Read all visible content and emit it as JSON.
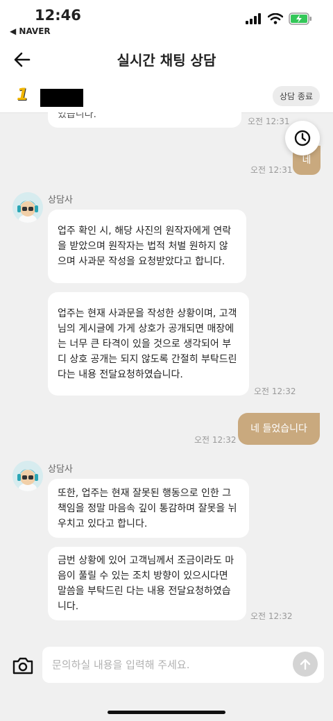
{
  "status_bar": {
    "time": "12:46",
    "back_app": "◀ NAVER"
  },
  "header": {
    "title": "실시간 채팅 상담"
  },
  "agent_bar": {
    "logo": "1",
    "end_button": "상담 종료"
  },
  "messages": {
    "m0": {
      "text": "었습니다.",
      "time": "오전 12:31"
    },
    "m1": {
      "text": "네",
      "time": "오전 12:31"
    },
    "group1": {
      "sender": "상담사",
      "b1": "업주 확인 시, 해당 사진의 원작자에게 연락을 받았으며 원작자는 법적 처벌 원하지 않으며 사과문 작성을 요청받았다고 합니다.",
      "b2": "업주는 현재 사과문을 작성한 상황이며, 고객님의 게시글에 가게 상호가 공개되면 매장에는 너무 큰 타격이 있을 것으로 생각되어 부디 상호 공개는 되지 않도록 간절히 부탁드린다는 내용 전달요청하였습니다.",
      "time": "오전 12:32"
    },
    "m2": {
      "text": "네 들었습니다",
      "time": "오전 12:32"
    },
    "group2": {
      "sender": "상담사",
      "b1": "또한, 업주는 현재 잘못된 행동으로 인한 그 책임을 정말 마음속 깊이 통감하며 잘못을 뉘우치고 있다고 합니다.",
      "b2": "금번 상황에 있어 고객님께서 조금이라도 마음이 풀릴 수 있는 조치 방향이 있으시다면 말씀을 부탁드린 다는 내용 전달요청하였습니다.",
      "time": "오전 12:32"
    }
  },
  "input": {
    "placeholder": "문의하실 내용을 입력해 주세요."
  },
  "colors": {
    "my_bubble": "#c9a97e",
    "background": "#f0f0f0",
    "brand_yellow": "#f2b705"
  }
}
